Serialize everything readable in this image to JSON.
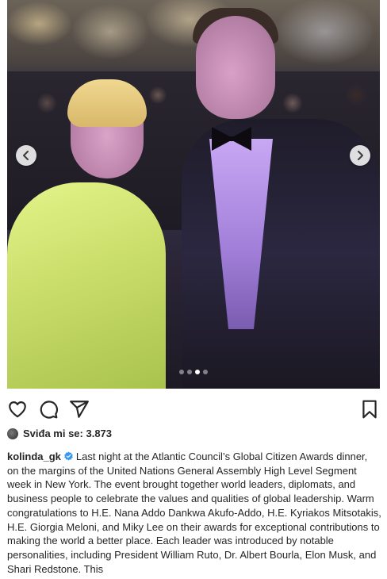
{
  "post": {
    "photo_alt": "",
    "carousel": {
      "count": 4,
      "active_index": 2
    },
    "likes_label": "Sviđa mi se: 3.873",
    "author": {
      "username": "kolinda_gk",
      "verified": true
    },
    "caption_text": "Last night at the Atlantic Council’s Global Citizen Awards dinner, on the margins of the United Nations General Assembly High Level Segment week in New York. The event brought together world leaders, diplomats, and business people to celebrate the values and qualities of global leadership. Warm congratulations to H.E. Nana Addo Dankwa Akufo-Addo, H.E. Kyriakos Mitsotakis, H.E. Giorgia Meloni, and Miky Lee on their awards for exceptional contributions to making the world a better place. Each leader was introduced by notable personalities, including President William Ruto, Dr. Albert Bourla, Elon Musk, and Shari Redstone. This"
  },
  "icons": {
    "prev": "chevron-left-icon",
    "next": "chevron-right-icon",
    "like": "heart-icon",
    "comment": "comment-icon",
    "share": "paper-plane-icon",
    "save": "bookmark-icon",
    "verified": "verified-badge-icon"
  },
  "colors": {
    "verified_blue": "#3897f0",
    "text": "#262626"
  }
}
